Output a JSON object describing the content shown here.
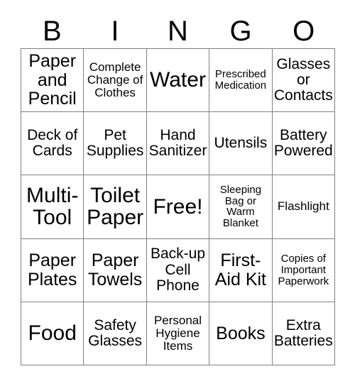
{
  "card": {
    "header_letters": [
      "B",
      "I",
      "N",
      "G",
      "O"
    ],
    "grid_size": "5x5",
    "border_color": "#808080",
    "text_color": "#000000",
    "background_color": "#ffffff",
    "rows": [
      [
        {
          "text": "Paper and Pencil",
          "size": "lg"
        },
        {
          "text": "Complete Change of Clothes",
          "size": "sm"
        },
        {
          "text": "Water",
          "size": "xl"
        },
        {
          "text": "Prescribed Medication",
          "size": "xs"
        },
        {
          "text": "Glasses or Contacts",
          "size": "md"
        }
      ],
      [
        {
          "text": "Deck of Cards",
          "size": "md"
        },
        {
          "text": "Pet Supplies",
          "size": "md"
        },
        {
          "text": "Hand Sanitizer",
          "size": "md"
        },
        {
          "text": "Utensils",
          "size": "md"
        },
        {
          "text": "Battery Powered",
          "size": "md"
        }
      ],
      [
        {
          "text": "Multi-Tool",
          "size": "xl"
        },
        {
          "text": "Toilet Paper",
          "size": "xl"
        },
        {
          "text": "Free!",
          "size": "xl"
        },
        {
          "text": "Sleeping Bag or Warm Blanket",
          "size": "xs"
        },
        {
          "text": "Flashlight",
          "size": "sm"
        }
      ],
      [
        {
          "text": "Paper Plates",
          "size": "lg"
        },
        {
          "text": "Paper Towels",
          "size": "lg"
        },
        {
          "text": "Back-up Cell Phone",
          "size": "md"
        },
        {
          "text": "First-Aid Kit",
          "size": "lg"
        },
        {
          "text": "Copies of Important Paperwork",
          "size": "xs"
        }
      ],
      [
        {
          "text": "Food",
          "size": "xl"
        },
        {
          "text": "Safety Glasses",
          "size": "md"
        },
        {
          "text": "Personal Hygiene Items",
          "size": "sm"
        },
        {
          "text": "Books",
          "size": "lg"
        },
        {
          "text": "Extra Batteries",
          "size": "md"
        }
      ]
    ]
  }
}
